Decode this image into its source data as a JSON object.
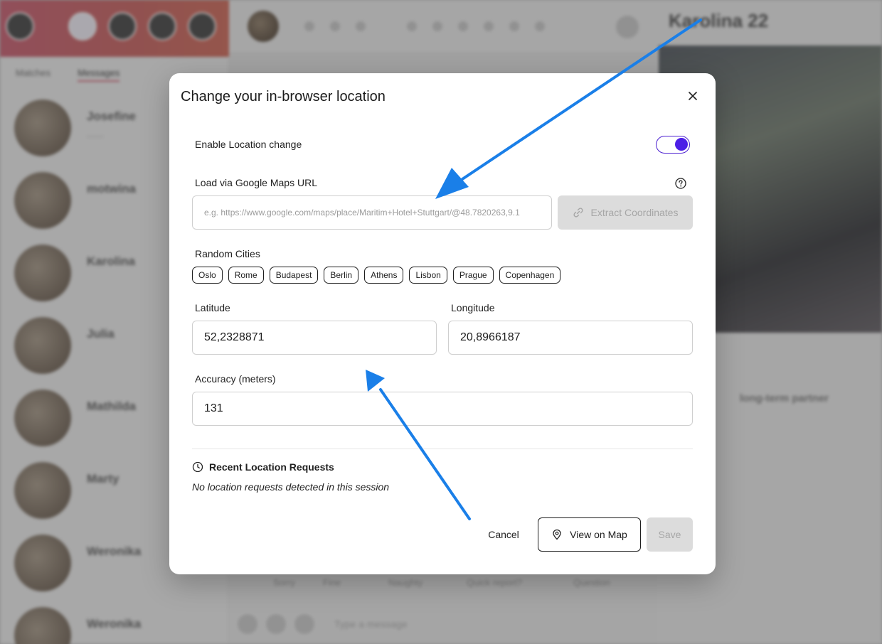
{
  "modal": {
    "title": "Change your in-browser location",
    "enable_label": "Enable Location change",
    "enable_state": true,
    "url_label": "Load via Google Maps URL",
    "url_placeholder": "e.g. https://www.google.com/maps/place/Maritim+Hotel+Stuttgart/@48.7820263,9.1",
    "extract_button": "Extract Coordinates",
    "random_cities_label": "Random Cities",
    "cities": [
      "Oslo",
      "Rome",
      "Budapest",
      "Berlin",
      "Athens",
      "Lisbon",
      "Prague",
      "Copenhagen"
    ],
    "latitude_label": "Latitude",
    "latitude_value": "52,2328871",
    "longitude_label": "Longitude",
    "longitude_value": "20,8966187",
    "accuracy_label": "Accuracy (meters)",
    "accuracy_value": "131",
    "recent_title": "Recent Location Requests",
    "recent_empty": "No location requests detected in this session",
    "cancel_button": "Cancel",
    "view_map_button": "View on Map",
    "save_button": "Save"
  },
  "background": {
    "tabs": [
      "Matches",
      "Messages"
    ],
    "matches": [
      {
        "name": "Josefine"
      },
      {
        "name": "motwina"
      },
      {
        "name": "Karolina"
      },
      {
        "name": "Julia"
      },
      {
        "name": "Mathilda"
      },
      {
        "name": "Marty"
      },
      {
        "name": "Weronika"
      },
      {
        "name": "Weronika"
      }
    ],
    "profile_name": "Karolina 22",
    "profile_goal": "long-term partner",
    "chips": [
      "Sorry",
      "Fine",
      "Naughty",
      "Quick report?",
      "Question"
    ],
    "message_placeholder": "Type a message"
  },
  "colors": {
    "accent": "#4c1fe6",
    "arrow": "#1a7fe8",
    "brand_gradient_start": "#c8566a",
    "brand_gradient_end": "#cf6251"
  },
  "icons": {
    "close": "close-icon",
    "help": "help-circle-icon",
    "link": "link-icon",
    "clock": "clock-icon",
    "map_pin": "map-pin-icon"
  }
}
